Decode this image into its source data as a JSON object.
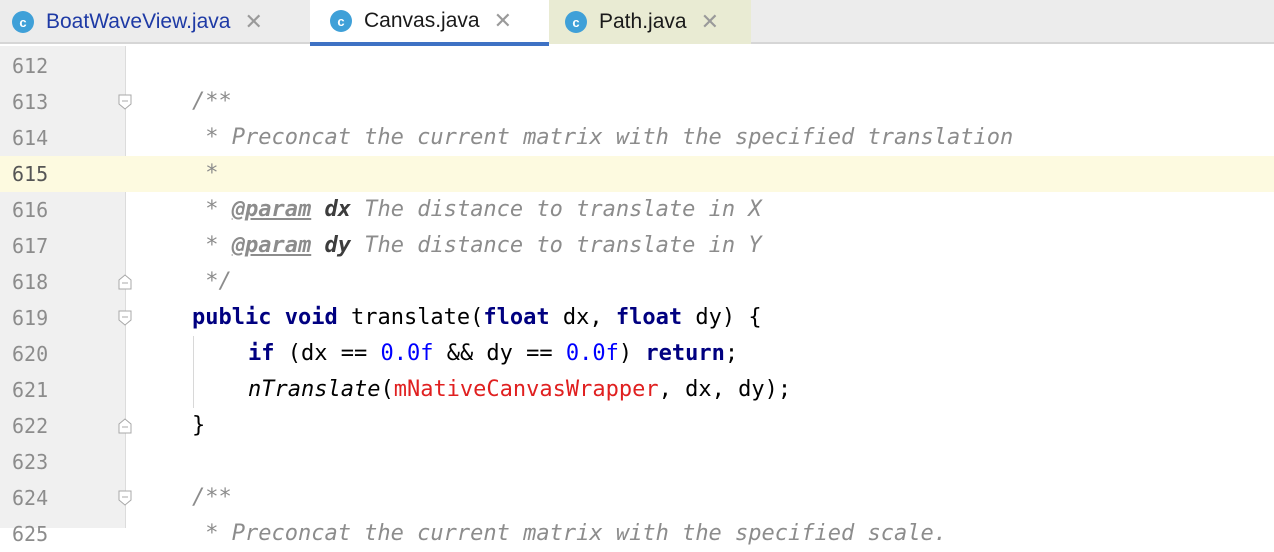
{
  "tabs": [
    {
      "icon": "class-icon",
      "icon_letter": "c",
      "label": "BoatWaveView.java",
      "close": "✕",
      "active": false
    },
    {
      "icon": "class-icon",
      "icon_letter": "c",
      "label": "Canvas.java",
      "close": "✕",
      "active": true
    },
    {
      "icon": "class-icon",
      "icon_letter": "c",
      "label": "Path.java",
      "close": "✕",
      "active": false
    }
  ],
  "line_numbers": [
    "612",
    "613",
    "614",
    "615",
    "616",
    "617",
    "618",
    "619",
    "620",
    "621",
    "622",
    "623",
    "624",
    "625"
  ],
  "current_line": "615",
  "code": {
    "l613": "/**",
    "l614": " * Preconcat the current matrix with the specified translation",
    "l615": " *",
    "l616_star": " * ",
    "l616_tag": "@param",
    "l616_name": "dx",
    "l616_desc": " The distance to translate in X",
    "l617_star": " * ",
    "l617_tag": "@param",
    "l617_name": "dy",
    "l617_desc": " The distance to translate in Y",
    "l618": " */",
    "l619_kw1": "public",
    "l619_kw2": "void",
    "l619_a": " translate(",
    "l619_kw3": "float",
    "l619_b": " dx, ",
    "l619_kw4": "float",
    "l619_c": " dy) {",
    "l620_kw1": "if",
    "l620_a": " (dx == ",
    "l620_n1": "0.0f",
    "l620_b": " && dy == ",
    "l620_n2": "0.0f",
    "l620_c": ") ",
    "l620_kw2": "return",
    "l620_d": ";",
    "l621_m": "nTranslate",
    "l621_a": "(",
    "l621_f": "mNativeCanvasWrapper",
    "l621_b": ", dx, dy);",
    "l622": "}",
    "l624": "/**",
    "l625": " * Preconcat the current matrix with the specified scale."
  },
  "colors": {
    "keyword": "#000080",
    "number": "#0000ff",
    "field": "#e02020",
    "comment": "#8c8c8c",
    "active_tab_underline": "#3e72c4",
    "current_line_bg": "#fdfae0"
  }
}
